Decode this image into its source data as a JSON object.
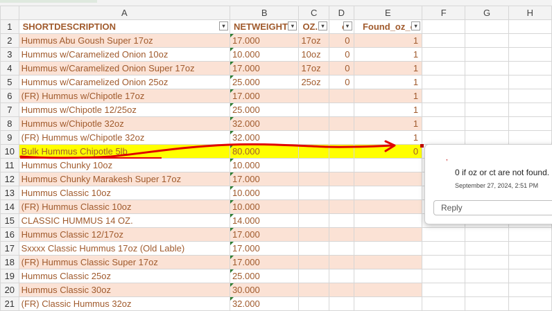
{
  "columns": [
    "",
    "A",
    "B",
    "C",
    "D",
    "E",
    "F",
    "G",
    "H"
  ],
  "header_row": {
    "num": "1",
    "cells": [
      "SHORTDESCRIPTION",
      "NETWEIGHT",
      "OZ.",
      "ct",
      "Found_oz_ct"
    ]
  },
  "rows": [
    {
      "num": "2",
      "a": "Hummus Abu Goush Super 17oz",
      "b": "17.000",
      "c": "17oz",
      "d": "0",
      "e": "1"
    },
    {
      "num": "3",
      "a": "Hummus w/Caramelized Onion 10oz",
      "b": "10.000",
      "c": "10oz",
      "d": "0",
      "e": "1"
    },
    {
      "num": "4",
      "a": "Hummus w/Caramelized Onion Super 17oz",
      "b": "17.000",
      "c": "17oz",
      "d": "0",
      "e": "1"
    },
    {
      "num": "5",
      "a": "Hummus w/Caramelized Onion 25oz",
      "b": "25.000",
      "c": "25oz",
      "d": "0",
      "e": "1"
    },
    {
      "num": "6",
      "a": "(FR) Hummus w/Chipotle 17oz",
      "b": "17.000",
      "c": "",
      "d": "",
      "e": "1"
    },
    {
      "num": "7",
      "a": "Hummus w/Chipotle 12/25oz",
      "b": "25.000",
      "c": "",
      "d": "",
      "e": "1"
    },
    {
      "num": "8",
      "a": "Hummus w/Chipotle 32oz",
      "b": "32.000",
      "c": "",
      "d": "",
      "e": "1"
    },
    {
      "num": "9",
      "a": "(FR) Hummus w/Chipotle 32oz",
      "b": "32.000",
      "c": "",
      "d": "",
      "e": "1"
    },
    {
      "num": "10",
      "a": "Bulk Hummus Chipotle 5lb",
      "b": "80.000",
      "c": "",
      "d": "",
      "e": "0"
    },
    {
      "num": "11",
      "a": "Hummus Chunky 10oz",
      "b": "10.000",
      "c": "",
      "d": "",
      "e": ""
    },
    {
      "num": "12",
      "a": "Hummus Chunky Marakesh Super 17oz",
      "b": "17.000",
      "c": "",
      "d": "",
      "e": ""
    },
    {
      "num": "13",
      "a": "Hummus Classic 10oz",
      "b": "10.000",
      "c": "",
      "d": "",
      "e": ""
    },
    {
      "num": "14",
      "a": "(FR) Hummus Classic 10oz",
      "b": "10.000",
      "c": "",
      "d": "",
      "e": ""
    },
    {
      "num": "15",
      "a": "CLASSIC HUMMUS 14 OZ.",
      "b": "14.000",
      "c": "",
      "d": "",
      "e": ""
    },
    {
      "num": "16",
      "a": "Hummus Classic 12/17oz",
      "b": "17.000",
      "c": "",
      "d": "",
      "e": ""
    },
    {
      "num": "17",
      "a": "Sxxxx Classic Hummus 17oz (Old Lable)",
      "b": "17.000",
      "c": "",
      "d": "",
      "e": ""
    },
    {
      "num": "18",
      "a": "(FR) Hummus Classic Super 17oz",
      "b": "17.000",
      "c": "",
      "d": "",
      "e": ""
    },
    {
      "num": "19",
      "a": "Hummus Classic 25oz",
      "b": "25.000",
      "c": "",
      "d": "",
      "e": ""
    },
    {
      "num": "20",
      "a": "Hummus Classic 30oz",
      "b": "30.000",
      "c": "",
      "d": "",
      "e": ""
    },
    {
      "num": "21",
      "a": "(FR) Classic Hummus 32oz",
      "b": "32.000",
      "c": "",
      "d": "",
      "e": ""
    }
  ],
  "comment": {
    "text": "0 if oz or ct are not found.",
    "timestamp": "September 27, 2024, 2:51 PM",
    "reply_placeholder": "Reply"
  },
  "colors": {
    "text_accent": "#a05a2c",
    "band": "#fbe2d5",
    "highlight": "#ffff00",
    "annotation": "#e00000"
  }
}
